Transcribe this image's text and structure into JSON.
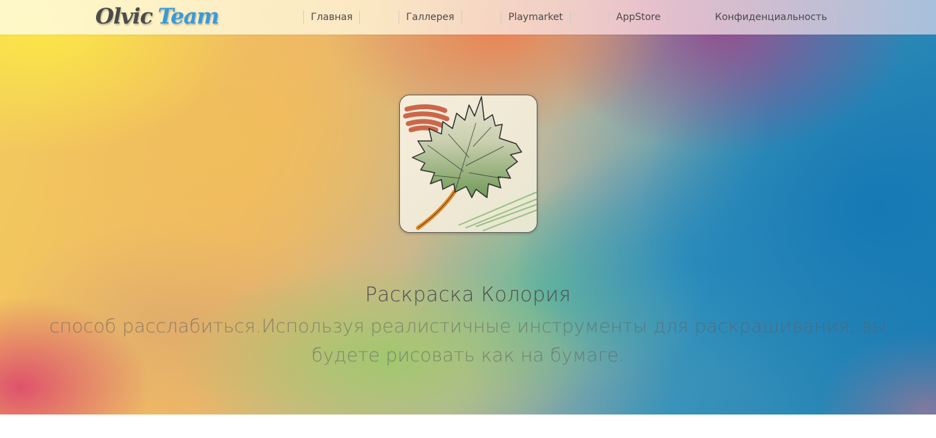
{
  "brand": {
    "logo_part1": "Olvic",
    "logo_part2": "Team"
  },
  "nav": {
    "items": [
      {
        "label": "Главная"
      },
      {
        "label": "Галлерея"
      },
      {
        "label": "Playmarket"
      },
      {
        "label": "AppStore"
      },
      {
        "label": "Конфиденциальность"
      }
    ]
  },
  "hero": {
    "icon": "maple-leaf-icon",
    "title": "Раскраска Колория",
    "description": "способ расслабиться.Используя реалистичные инструменты для раскрашивания, вы будете рисовать как на бумаге."
  },
  "colors": {
    "logo_dark": "#4b4b4b",
    "logo_accent": "#3a9ad8",
    "nav_text": "#4a4a4a",
    "title_text": "#4f4f4f"
  }
}
